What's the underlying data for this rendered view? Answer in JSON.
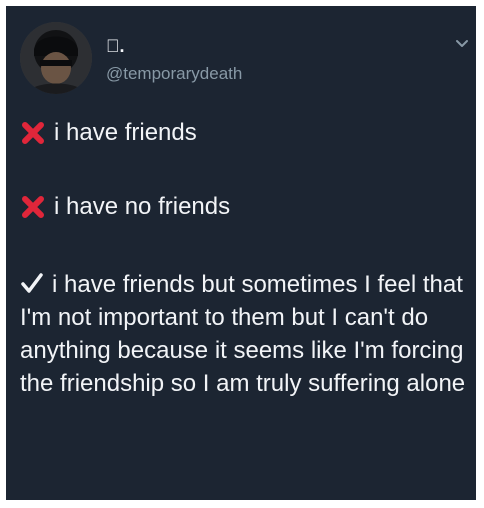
{
  "tweet": {
    "display_name": "\u0000.",
    "handle": "@temporarydeath",
    "lines": [
      {
        "icon": "red-x-icon",
        "text": "i have friends"
      },
      {
        "icon": "red-x-icon",
        "text": "i have no friends"
      }
    ],
    "final": {
      "icon": "checkmark-icon",
      "text": "i have friends but sometimes I feel that I'm not important to them but I can't do anything because it seems like I'm forcing the friendship so I am truly suffering alone"
    }
  },
  "colors": {
    "background": "#1c2532",
    "text": "#f2f4f7",
    "muted": "#8899a6",
    "x_mark": "#e0263a"
  }
}
